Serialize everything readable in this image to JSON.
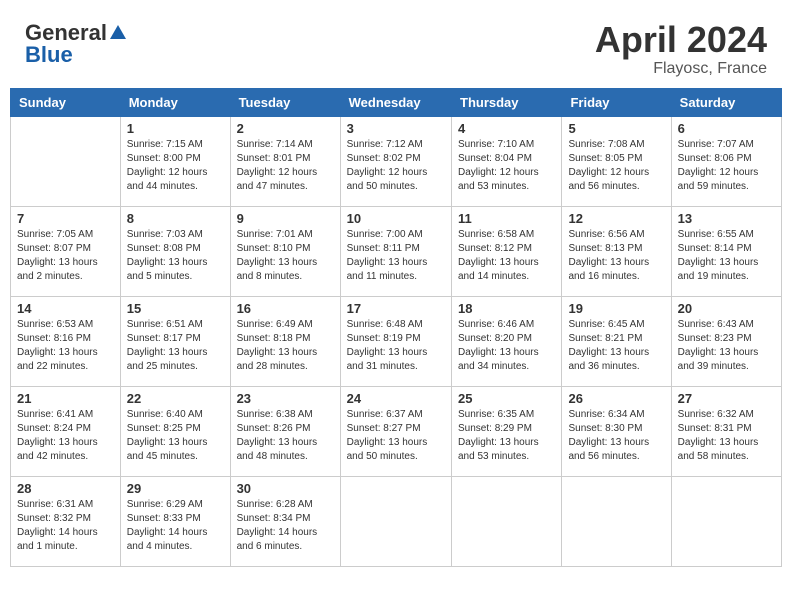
{
  "header": {
    "logo_general": "General",
    "logo_blue": "Blue",
    "month_year": "April 2024",
    "location": "Flayosc, France"
  },
  "weekdays": [
    "Sunday",
    "Monday",
    "Tuesday",
    "Wednesday",
    "Thursday",
    "Friday",
    "Saturday"
  ],
  "weeks": [
    [
      {
        "day": "",
        "info": ""
      },
      {
        "day": "1",
        "info": "Sunrise: 7:15 AM\nSunset: 8:00 PM\nDaylight: 12 hours\nand 44 minutes."
      },
      {
        "day": "2",
        "info": "Sunrise: 7:14 AM\nSunset: 8:01 PM\nDaylight: 12 hours\nand 47 minutes."
      },
      {
        "day": "3",
        "info": "Sunrise: 7:12 AM\nSunset: 8:02 PM\nDaylight: 12 hours\nand 50 minutes."
      },
      {
        "day": "4",
        "info": "Sunrise: 7:10 AM\nSunset: 8:04 PM\nDaylight: 12 hours\nand 53 minutes."
      },
      {
        "day": "5",
        "info": "Sunrise: 7:08 AM\nSunset: 8:05 PM\nDaylight: 12 hours\nand 56 minutes."
      },
      {
        "day": "6",
        "info": "Sunrise: 7:07 AM\nSunset: 8:06 PM\nDaylight: 12 hours\nand 59 minutes."
      }
    ],
    [
      {
        "day": "7",
        "info": "Sunrise: 7:05 AM\nSunset: 8:07 PM\nDaylight: 13 hours\nand 2 minutes."
      },
      {
        "day": "8",
        "info": "Sunrise: 7:03 AM\nSunset: 8:08 PM\nDaylight: 13 hours\nand 5 minutes."
      },
      {
        "day": "9",
        "info": "Sunrise: 7:01 AM\nSunset: 8:10 PM\nDaylight: 13 hours\nand 8 minutes."
      },
      {
        "day": "10",
        "info": "Sunrise: 7:00 AM\nSunset: 8:11 PM\nDaylight: 13 hours\nand 11 minutes."
      },
      {
        "day": "11",
        "info": "Sunrise: 6:58 AM\nSunset: 8:12 PM\nDaylight: 13 hours\nand 14 minutes."
      },
      {
        "day": "12",
        "info": "Sunrise: 6:56 AM\nSunset: 8:13 PM\nDaylight: 13 hours\nand 16 minutes."
      },
      {
        "day": "13",
        "info": "Sunrise: 6:55 AM\nSunset: 8:14 PM\nDaylight: 13 hours\nand 19 minutes."
      }
    ],
    [
      {
        "day": "14",
        "info": "Sunrise: 6:53 AM\nSunset: 8:16 PM\nDaylight: 13 hours\nand 22 minutes."
      },
      {
        "day": "15",
        "info": "Sunrise: 6:51 AM\nSunset: 8:17 PM\nDaylight: 13 hours\nand 25 minutes."
      },
      {
        "day": "16",
        "info": "Sunrise: 6:49 AM\nSunset: 8:18 PM\nDaylight: 13 hours\nand 28 minutes."
      },
      {
        "day": "17",
        "info": "Sunrise: 6:48 AM\nSunset: 8:19 PM\nDaylight: 13 hours\nand 31 minutes."
      },
      {
        "day": "18",
        "info": "Sunrise: 6:46 AM\nSunset: 8:20 PM\nDaylight: 13 hours\nand 34 minutes."
      },
      {
        "day": "19",
        "info": "Sunrise: 6:45 AM\nSunset: 8:21 PM\nDaylight: 13 hours\nand 36 minutes."
      },
      {
        "day": "20",
        "info": "Sunrise: 6:43 AM\nSunset: 8:23 PM\nDaylight: 13 hours\nand 39 minutes."
      }
    ],
    [
      {
        "day": "21",
        "info": "Sunrise: 6:41 AM\nSunset: 8:24 PM\nDaylight: 13 hours\nand 42 minutes."
      },
      {
        "day": "22",
        "info": "Sunrise: 6:40 AM\nSunset: 8:25 PM\nDaylight: 13 hours\nand 45 minutes."
      },
      {
        "day": "23",
        "info": "Sunrise: 6:38 AM\nSunset: 8:26 PM\nDaylight: 13 hours\nand 48 minutes."
      },
      {
        "day": "24",
        "info": "Sunrise: 6:37 AM\nSunset: 8:27 PM\nDaylight: 13 hours\nand 50 minutes."
      },
      {
        "day": "25",
        "info": "Sunrise: 6:35 AM\nSunset: 8:29 PM\nDaylight: 13 hours\nand 53 minutes."
      },
      {
        "day": "26",
        "info": "Sunrise: 6:34 AM\nSunset: 8:30 PM\nDaylight: 13 hours\nand 56 minutes."
      },
      {
        "day": "27",
        "info": "Sunrise: 6:32 AM\nSunset: 8:31 PM\nDaylight: 13 hours\nand 58 minutes."
      }
    ],
    [
      {
        "day": "28",
        "info": "Sunrise: 6:31 AM\nSunset: 8:32 PM\nDaylight: 14 hours\nand 1 minute."
      },
      {
        "day": "29",
        "info": "Sunrise: 6:29 AM\nSunset: 8:33 PM\nDaylight: 14 hours\nand 4 minutes."
      },
      {
        "day": "30",
        "info": "Sunrise: 6:28 AM\nSunset: 8:34 PM\nDaylight: 14 hours\nand 6 minutes."
      },
      {
        "day": "",
        "info": ""
      },
      {
        "day": "",
        "info": ""
      },
      {
        "day": "",
        "info": ""
      },
      {
        "day": "",
        "info": ""
      }
    ]
  ]
}
